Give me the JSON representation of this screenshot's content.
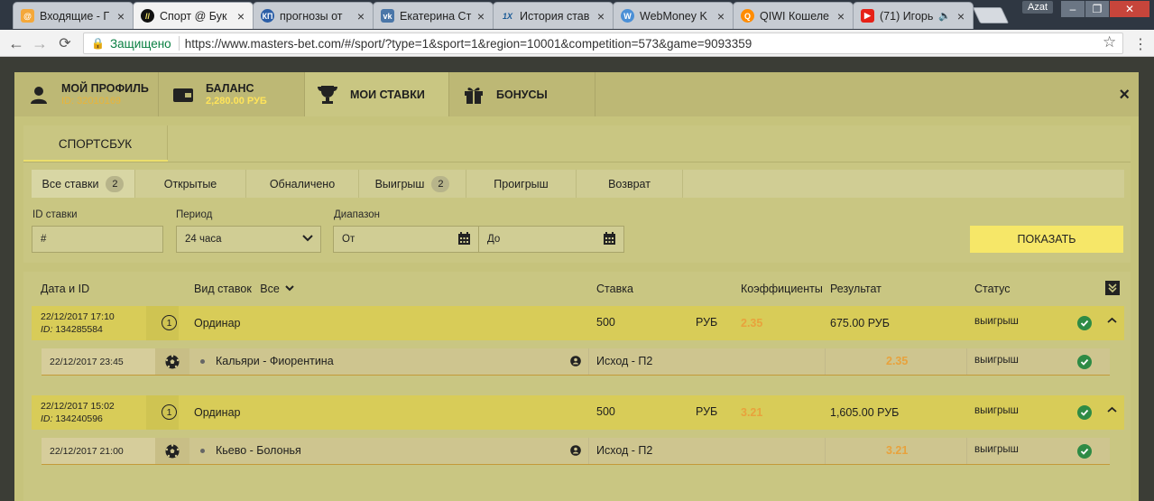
{
  "browser": {
    "tabs": [
      {
        "title": "Входящие - Г",
        "favicon": "mail-icon",
        "color": "#f4a83a"
      },
      {
        "title": "Спорт @ Бук",
        "favicon": "masters-bet-icon",
        "color": "#222222"
      },
      {
        "title": "прогнозы от",
        "favicon": "kp-icon",
        "color": "#2b5ea7"
      },
      {
        "title": "Екатерина Ст",
        "favicon": "vk-icon",
        "color": "#4a76a8"
      },
      {
        "title": "История став",
        "favicon": "1xbet-icon",
        "color": "#1a5a96"
      },
      {
        "title": "WebMoney K",
        "favicon": "webmoney-icon",
        "color": "#4a8fd6"
      },
      {
        "title": "QIWI Кошеле",
        "favicon": "qiwi-icon",
        "color": "#ff8c00"
      },
      {
        "title": "(71) Игорь",
        "favicon": "youtube-icon",
        "color": "#e62117"
      }
    ],
    "active_tab_index": 1,
    "profile_label": "Azat",
    "secure_label": "Защищено",
    "url": "https://www.masters-bet.com/#/sport/?type=1&sport=1&region=10001&competition=573&game=9093359"
  },
  "modal": {
    "tabs": [
      {
        "title": "МОЙ ПРОФИЛЬ",
        "subtitle": "ID: 32010169",
        "icon": "user-icon"
      },
      {
        "title": "БАЛАНС",
        "subtitle": "2,280.00 РУБ",
        "icon": "wallet-icon"
      },
      {
        "title": "МОИ СТАВКИ",
        "subtitle": "",
        "icon": "trophy-icon"
      },
      {
        "title": "БОНУСЫ",
        "subtitle": "",
        "icon": "gift-icon"
      }
    ],
    "close_symbol": "×",
    "subtab": "СПОРТСБУК",
    "filters": [
      {
        "label": "Все ставки",
        "badge": "2"
      },
      {
        "label": "Открытые",
        "badge": ""
      },
      {
        "label": "Обналичено",
        "badge": ""
      },
      {
        "label": "Выигрыш",
        "badge": "2"
      },
      {
        "label": "Проигрыш",
        "badge": ""
      },
      {
        "label": "Возврат",
        "badge": ""
      }
    ],
    "form": {
      "id_label": "ID ставки",
      "id_value": "#",
      "period_label": "Период",
      "period_value": "24 часа",
      "range_label": "Диапазон",
      "from_value": "От",
      "to_value": "До",
      "show_button": "ПОКАЗАТЬ"
    },
    "table": {
      "headers": {
        "date_id": "Дата и ID",
        "bet_type": "Вид ставок",
        "bet_type_filter": "Все",
        "stake": "Ставка",
        "odds": "Коэффициенты",
        "result": "Результат",
        "status": "Статус"
      },
      "bets": [
        {
          "date": "22/12/2017 17:10",
          "id_label": "ID:",
          "id": "134285584",
          "count": "1",
          "type": "Ординар",
          "stake": "500",
          "currency": "РУБ",
          "odds": "2.35",
          "result": "675.00 РУБ",
          "status": "выигрыш",
          "event": {
            "date": "22/12/2017 23:45",
            "teams": "Кальяри - Фиорентина",
            "market": "Исход - П2",
            "odds": "2.35",
            "status": "выигрыш"
          }
        },
        {
          "date": "22/12/2017 15:02",
          "id_label": "ID:",
          "id": "134240596",
          "count": "1",
          "type": "Ординар",
          "stake": "500",
          "currency": "РУБ",
          "odds": "3.21",
          "result": "1,605.00 РУБ",
          "status": "выигрыш",
          "event": {
            "date": "22/12/2017 21:00",
            "teams": "Кьево - Болонья",
            "market": "Исход - П2",
            "odds": "3.21",
            "status": "выигрыш"
          }
        }
      ]
    }
  }
}
